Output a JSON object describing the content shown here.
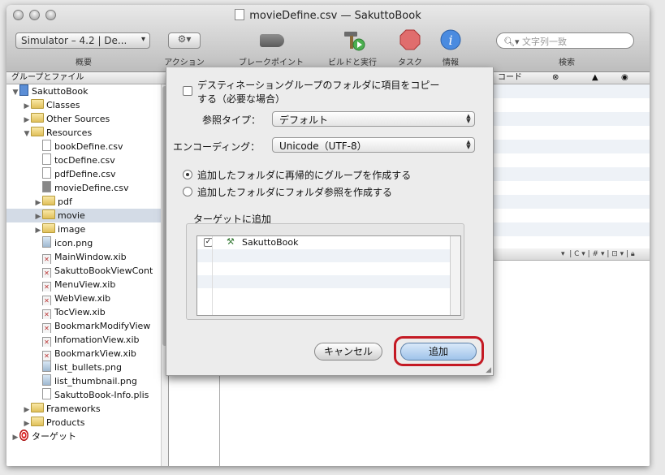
{
  "window": {
    "title": "movieDefine.csv — SakuttoBook"
  },
  "toolbar": {
    "scheme_popup": "Simulator – 4.2 | De...",
    "labels": [
      "概要",
      "アクション",
      "ブレークポイント",
      "ビルドと実行",
      "タスク",
      "情報",
      "検索"
    ],
    "search_placeholder": "文字列一致"
  },
  "sidebar": {
    "header": "グループとファイル",
    "items": [
      {
        "label": "SakuttoBook",
        "depth": 0,
        "kind": "project",
        "disclosure": "open"
      },
      {
        "label": "Classes",
        "depth": 1,
        "kind": "folder",
        "disclosure": "closed"
      },
      {
        "label": "Other Sources",
        "depth": 1,
        "kind": "folder",
        "disclosure": "closed"
      },
      {
        "label": "Resources",
        "depth": 1,
        "kind": "folder",
        "disclosure": "open"
      },
      {
        "label": "bookDefine.csv",
        "depth": 2,
        "kind": "file"
      },
      {
        "label": "tocDefine.csv",
        "depth": 2,
        "kind": "file"
      },
      {
        "label": "pdfDefine.csv",
        "depth": 2,
        "kind": "file"
      },
      {
        "label": "movieDefine.csv",
        "depth": 2,
        "kind": "file-dark"
      },
      {
        "label": "pdf",
        "depth": 2,
        "kind": "folder",
        "disclosure": "closed"
      },
      {
        "label": "movie",
        "depth": 2,
        "kind": "folder",
        "disclosure": "closed",
        "selected": true
      },
      {
        "label": "image",
        "depth": 2,
        "kind": "folder",
        "disclosure": "closed"
      },
      {
        "label": "icon.png",
        "depth": 2,
        "kind": "image"
      },
      {
        "label": "MainWindow.xib",
        "depth": 2,
        "kind": "xib"
      },
      {
        "label": "SakuttoBookViewCont",
        "depth": 2,
        "kind": "xib"
      },
      {
        "label": "MenuView.xib",
        "depth": 2,
        "kind": "xib"
      },
      {
        "label": "WebView.xib",
        "depth": 2,
        "kind": "xib"
      },
      {
        "label": "TocView.xib",
        "depth": 2,
        "kind": "xib"
      },
      {
        "label": "BookmarkModifyView",
        "depth": 2,
        "kind": "xib"
      },
      {
        "label": "InfomationView.xib",
        "depth": 2,
        "kind": "xib"
      },
      {
        "label": "BookmarkView.xib",
        "depth": 2,
        "kind": "xib"
      },
      {
        "label": "list_bullets.png",
        "depth": 2,
        "kind": "image"
      },
      {
        "label": "list_thumbnail.png",
        "depth": 2,
        "kind": "image"
      },
      {
        "label": "SakuttoBook-Info.plis",
        "depth": 2,
        "kind": "file"
      },
      {
        "label": "Frameworks",
        "depth": 1,
        "kind": "folder",
        "disclosure": "closed"
      },
      {
        "label": "Products",
        "depth": 1,
        "kind": "folder",
        "disclosure": "closed"
      },
      {
        "label": "ターゲット",
        "depth": 0,
        "kind": "target",
        "disclosure": "closed"
      }
    ]
  },
  "list": {
    "column_code": "コード"
  },
  "dialog": {
    "copy_checkbox_line1": "デスティネーショングループのフォルダに項目をコピー",
    "copy_checkbox_line2": "する（必要な場合）",
    "reference_label": "参照タイプ：",
    "reference_value": "デフォルト",
    "encoding_label": "エンコーディング：",
    "encoding_value": "Unicode（UTF-8）",
    "radio_groups": "追加したフォルダに再帰的にグループを作成する",
    "radio_refs": "追加したフォルダにフォルダ参照を作成する",
    "targets_label": "ターゲットに追加",
    "target_item": "SakuttoBook",
    "cancel": "キャンセル",
    "add": "追加"
  }
}
